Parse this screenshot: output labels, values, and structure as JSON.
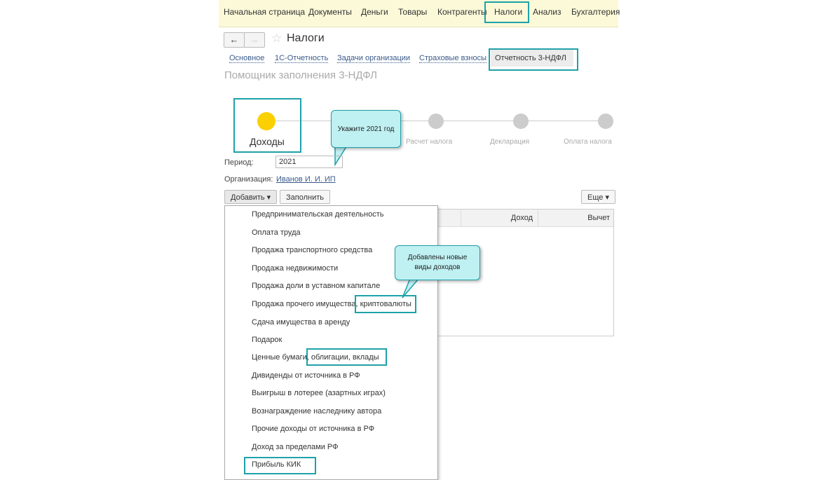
{
  "topnav": [
    "Начальная страница",
    "Документы",
    "Деньги",
    "Товары",
    "Контрагенты",
    "Налоги",
    "Анализ",
    "Бухгалтерия"
  ],
  "page_title": "Налоги",
  "tabs": [
    "Основное",
    "1С-Отчетность",
    "Задачи организации",
    "Страховые взносы",
    "Отчетность 3-НДФЛ"
  ],
  "subtitle": "Помощник заполнения 3-НДФЛ",
  "steps": [
    "Доходы",
    "Расчет налога",
    "Декларация",
    "Оплата налога"
  ],
  "callout1": "Укажите 2021 год",
  "period_label": "Период:",
  "period_value": "2021",
  "org_label": "Организация:",
  "org_value": "Иванов И. И. ИП",
  "add_button": "Добавить",
  "fill_button": "Заполнить",
  "more_button": "Еще",
  "table_headers": [
    "Доход",
    "Вычет"
  ],
  "callout2": "Добавлены новые виды доходов",
  "menu_items": [
    "Предпринимательская деятельность",
    "Оплата труда",
    "Продажа транспортного средства",
    "Продажа недвижимости",
    "Продажа доли в уставном капитале",
    "Продажа прочего имущества, криптовалюты",
    "Сдача имущества в аренду",
    "Подарок",
    "Ценные бумаги, облигации, вклады",
    "Дивиденды от источника в РФ",
    "Выигрыш в лотерее (азартных играх)",
    "Вознаграждение наследнику автора",
    "Прочие доходы от источника в РФ",
    "Доход за пределами РФ",
    "Прибыль КИК"
  ]
}
